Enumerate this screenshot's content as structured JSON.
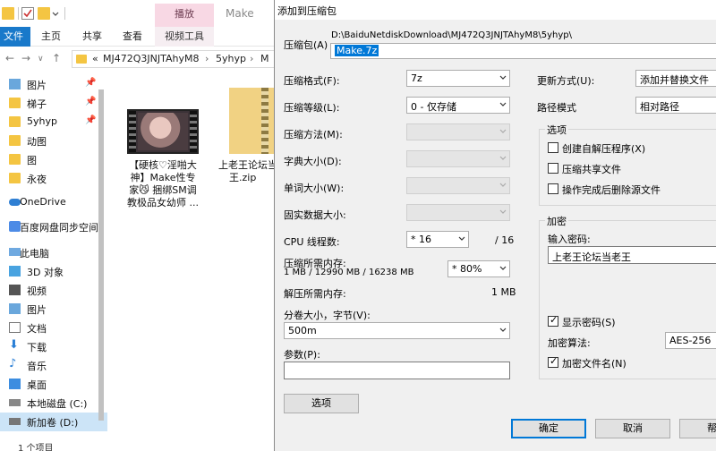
{
  "explorer": {
    "tool_header": "播放",
    "window_title": "Make",
    "tabs": {
      "file": "文件",
      "home": "主页",
      "share": "共享",
      "view": "查看",
      "video_tools": "视频工具"
    },
    "address": {
      "prefix": "«",
      "crumbs": [
        "MJ472Q3JNJTAhyM8",
        "5yhyp",
        "M"
      ]
    },
    "sidebar": [
      {
        "label": "图片",
        "pinned": true
      },
      {
        "label": "梯子",
        "pinned": true
      },
      {
        "label": "5yhyp",
        "pinned": true
      },
      {
        "label": "动图",
        "pinned": false
      },
      {
        "label": "图",
        "pinned": false
      },
      {
        "label": "永夜",
        "pinned": false
      },
      {
        "label": "OneDrive",
        "pinned": false
      },
      {
        "label": "百度网盘同步空间",
        "pinned": false
      },
      {
        "label": "此电脑",
        "pinned": false
      },
      {
        "label": "3D 对象",
        "pinned": false
      },
      {
        "label": "视频",
        "pinned": false
      },
      {
        "label": "图片",
        "pinned": false
      },
      {
        "label": "文档",
        "pinned": false
      },
      {
        "label": "下载",
        "pinned": false
      },
      {
        "label": "音乐",
        "pinned": false
      },
      {
        "label": "桌面",
        "pinned": false
      },
      {
        "label": "本地磁盘 (C:)",
        "pinned": false
      },
      {
        "label": "新加卷 (D:)",
        "pinned": false
      }
    ],
    "files": [
      {
        "lines": [
          "【硬核♡淫啪大",
          "神】Make性专",
          "家😼 捆绑SM调",
          "教极品女幼师 ..."
        ]
      },
      {
        "lines": [
          "上老王论坛当",
          "王.zip"
        ]
      }
    ],
    "status": "1 个项目"
  },
  "dialog": {
    "title": "添加到压缩包",
    "archive_label": "压缩包(A)",
    "archive_path": "D:\\BaiduNetdiskDownload\\MJ472Q3JNJTAhyM8\\5yhyp\\",
    "archive_name": "Make.7z",
    "format_label": "压缩格式(F):",
    "format_value": "7z",
    "level_label": "压缩等级(L):",
    "level_value": "0 - 仅存储",
    "method_label": "压缩方法(M):",
    "dict_label": "字典大小(D):",
    "word_label": "单词大小(W):",
    "solid_label": "固实数据大小:",
    "threads_label": "CPU 线程数:",
    "threads_value": "* 16",
    "threads_max": "/ 16",
    "mem_comp_label": "压缩所需内存:",
    "mem_comp_detail": "1 MB / 12990 MB / 16238 MB",
    "mem_percent": "* 80%",
    "mem_decomp_label": "解压所需内存:",
    "mem_decomp_value": "1 MB",
    "split_label": "分卷大小，字节(V):",
    "split_value": "500m",
    "params_label": "参数(P):",
    "params_value": "",
    "options_button": "选项",
    "update_label": "更新方式(U):",
    "update_value": "添加并替换文件",
    "path_mode_label": "路径模式",
    "path_mode_value": "相对路径",
    "options_group": "选项",
    "opt_sfx": "创建自解压程序(X)",
    "opt_shared": "压缩共享文件",
    "opt_delete": "操作完成后删除源文件",
    "enc_group": "加密",
    "enc_pw_label": "输入密码:",
    "enc_pw_value": "上老王论坛当老王",
    "show_pw": "显示密码(S)",
    "enc_algo_label": "加密算法:",
    "enc_algo_value": "AES-256",
    "enc_names": "加密文件名(N)",
    "ok_button": "确定",
    "cancel_button": "取消",
    "help_button": "帮"
  }
}
